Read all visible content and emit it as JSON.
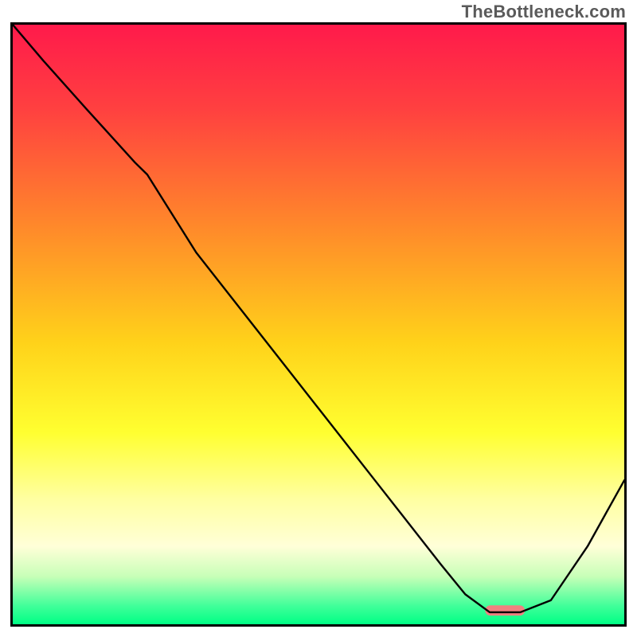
{
  "watermark": "TheBottleneck.com",
  "chart_data": {
    "type": "line",
    "title": "",
    "xlabel": "",
    "ylabel": "",
    "xlim": [
      0,
      100
    ],
    "ylim": [
      0,
      100
    ],
    "grid": false,
    "background_gradient": {
      "stops": [
        {
          "offset": 0,
          "color": "#ff1a4b"
        },
        {
          "offset": 14,
          "color": "#ff4040"
        },
        {
          "offset": 34,
          "color": "#ff8a2a"
        },
        {
          "offset": 53,
          "color": "#ffd21a"
        },
        {
          "offset": 68,
          "color": "#ffff30"
        },
        {
          "offset": 79,
          "color": "#ffffa0"
        },
        {
          "offset": 87,
          "color": "#ffffd8"
        },
        {
          "offset": 92,
          "color": "#c8ffb8"
        },
        {
          "offset": 97,
          "color": "#3fff99"
        },
        {
          "offset": 100,
          "color": "#00ff85"
        }
      ]
    },
    "series": [
      {
        "name": "curve",
        "color": "#000000",
        "width": 2.4,
        "x": [
          0,
          5,
          12,
          20,
          22,
          30,
          40,
          50,
          60,
          70,
          74,
          78,
          83,
          88,
          94,
          100
        ],
        "y": [
          100,
          94,
          86,
          77,
          75,
          62,
          49,
          36,
          23,
          10,
          5,
          2,
          2,
          4,
          13,
          24
        ]
      }
    ],
    "marker": {
      "x": 80.5,
      "y": 2.3,
      "width": 6.5,
      "height": 1.7,
      "color": "#f08080",
      "rx": 6
    }
  }
}
